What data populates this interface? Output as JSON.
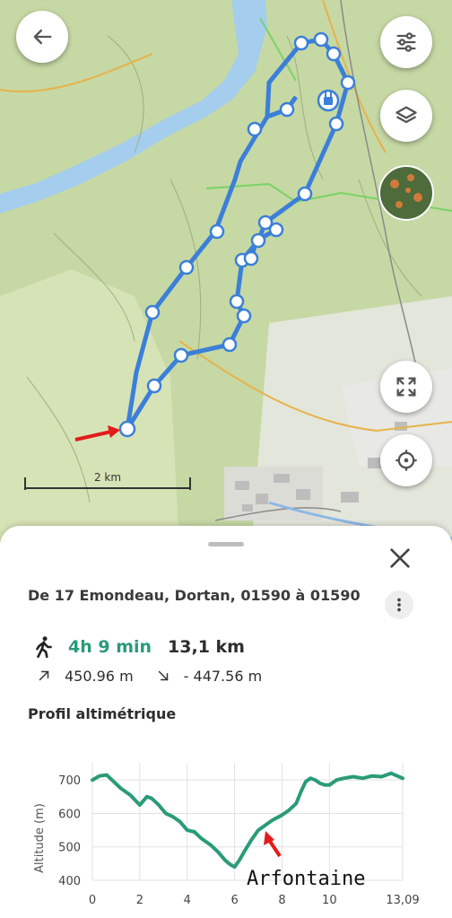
{
  "map": {
    "scale_label": "2 km",
    "colors": {
      "route": "#3b7fd9",
      "marker": "#e31b1b",
      "marker_end": "#d81b60"
    }
  },
  "route": {
    "title": "De 17 Emondeau, Dortan, 01590 à 01590",
    "duration": "4h 9 min",
    "distance": "13,1 km",
    "ascent": "450.96 m",
    "descent": "- 447.56 m"
  },
  "profile": {
    "section_title": "Profil altimétrique"
  },
  "icons": {
    "back": "arrow-left-icon",
    "filters": "sliders-icon",
    "layers": "layers-icon",
    "fullscreen": "expand-icon",
    "locate": "crosshair-icon",
    "close": "close-icon",
    "more": "vertical-dots-icon",
    "walk": "walking-person-icon",
    "ascent": "arrow-up-right-icon",
    "descent": "arrow-down-right-icon"
  },
  "chart_data": {
    "type": "line",
    "title": "",
    "xlabel": "",
    "ylabel": "Altitude (m)",
    "xlim": [
      0,
      13.09
    ],
    "ylim": [
      400,
      730
    ],
    "x_ticks": [
      "0",
      "2",
      "4",
      "6",
      "8",
      "10",
      "13,09"
    ],
    "y_ticks": [
      "700",
      "600",
      "500",
      "400"
    ],
    "grid": true,
    "color": "#2a9b78",
    "x": [
      0,
      0.3,
      0.6,
      0.9,
      1.2,
      1.6,
      2.0,
      2.3,
      2.5,
      2.8,
      3.1,
      3.4,
      3.7,
      4.0,
      4.3,
      4.6,
      5.0,
      5.3,
      5.6,
      5.8,
      6.0,
      6.2,
      6.4,
      6.7,
      7.0,
      7.3,
      7.6,
      8.0,
      8.3,
      8.6,
      8.8,
      9.0,
      9.2,
      9.4,
      9.6,
      9.8,
      10.0,
      10.3,
      10.6,
      11.0,
      11.4,
      11.8,
      12.2,
      12.6,
      13.09
    ],
    "y": [
      700,
      712,
      715,
      695,
      675,
      655,
      625,
      650,
      645,
      625,
      600,
      590,
      575,
      550,
      545,
      525,
      505,
      485,
      460,
      448,
      440,
      460,
      485,
      520,
      550,
      565,
      580,
      595,
      610,
      630,
      665,
      695,
      705,
      700,
      690,
      685,
      685,
      700,
      705,
      710,
      705,
      712,
      710,
      720,
      705
    ],
    "annotations": [
      {
        "text": "Arfontaine",
        "x": 7.2,
        "y": 540
      }
    ]
  }
}
